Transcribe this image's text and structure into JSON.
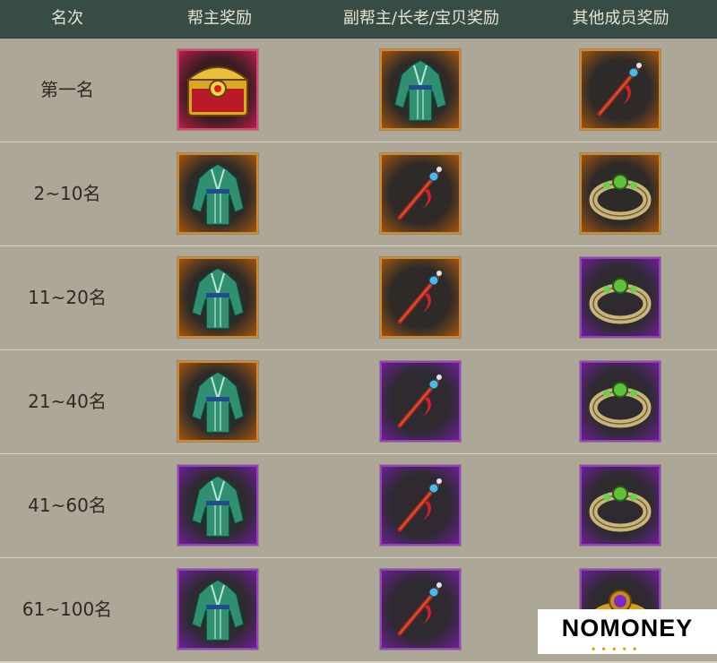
{
  "header": {
    "col_rank": "名次",
    "col_leader": "帮主奖励",
    "col_vice": "副帮主/长老/宝贝奖励",
    "col_member": "其他成员奖励"
  },
  "rows": [
    {
      "rank": "第一名",
      "leader": {
        "item": "treasure-chest",
        "frame": "pink"
      },
      "vice": {
        "item": "robe",
        "frame": "orange"
      },
      "member": {
        "item": "hairpin",
        "frame": "orange"
      }
    },
    {
      "rank": "2~10名",
      "leader": {
        "item": "robe",
        "frame": "orange"
      },
      "vice": {
        "item": "hairpin",
        "frame": "orange"
      },
      "member": {
        "item": "ring",
        "frame": "orange"
      }
    },
    {
      "rank": "11~20名",
      "leader": {
        "item": "robe",
        "frame": "orange"
      },
      "vice": {
        "item": "hairpin",
        "frame": "orange"
      },
      "member": {
        "item": "ring",
        "frame": "purple"
      }
    },
    {
      "rank": "21~40名",
      "leader": {
        "item": "robe",
        "frame": "orange"
      },
      "vice": {
        "item": "hairpin",
        "frame": "purple"
      },
      "member": {
        "item": "ring",
        "frame": "purple"
      }
    },
    {
      "rank": "41~60名",
      "leader": {
        "item": "robe",
        "frame": "purple"
      },
      "vice": {
        "item": "hairpin",
        "frame": "purple"
      },
      "member": {
        "item": "ring",
        "frame": "purple"
      }
    },
    {
      "rank": "61~100名",
      "leader": {
        "item": "robe",
        "frame": "purple"
      },
      "vice": {
        "item": "hairpin",
        "frame": "purple"
      },
      "member": {
        "item": "gold-ring",
        "frame": "purple"
      }
    }
  ],
  "watermark": {
    "text": "NOMONEY",
    "dots": "• • • • •"
  },
  "colors": {
    "header_bg": "#384c46",
    "orange_frame": "#d48a2a",
    "purple_frame": "#9a3ec8",
    "pink_frame": "#e2407a"
  }
}
